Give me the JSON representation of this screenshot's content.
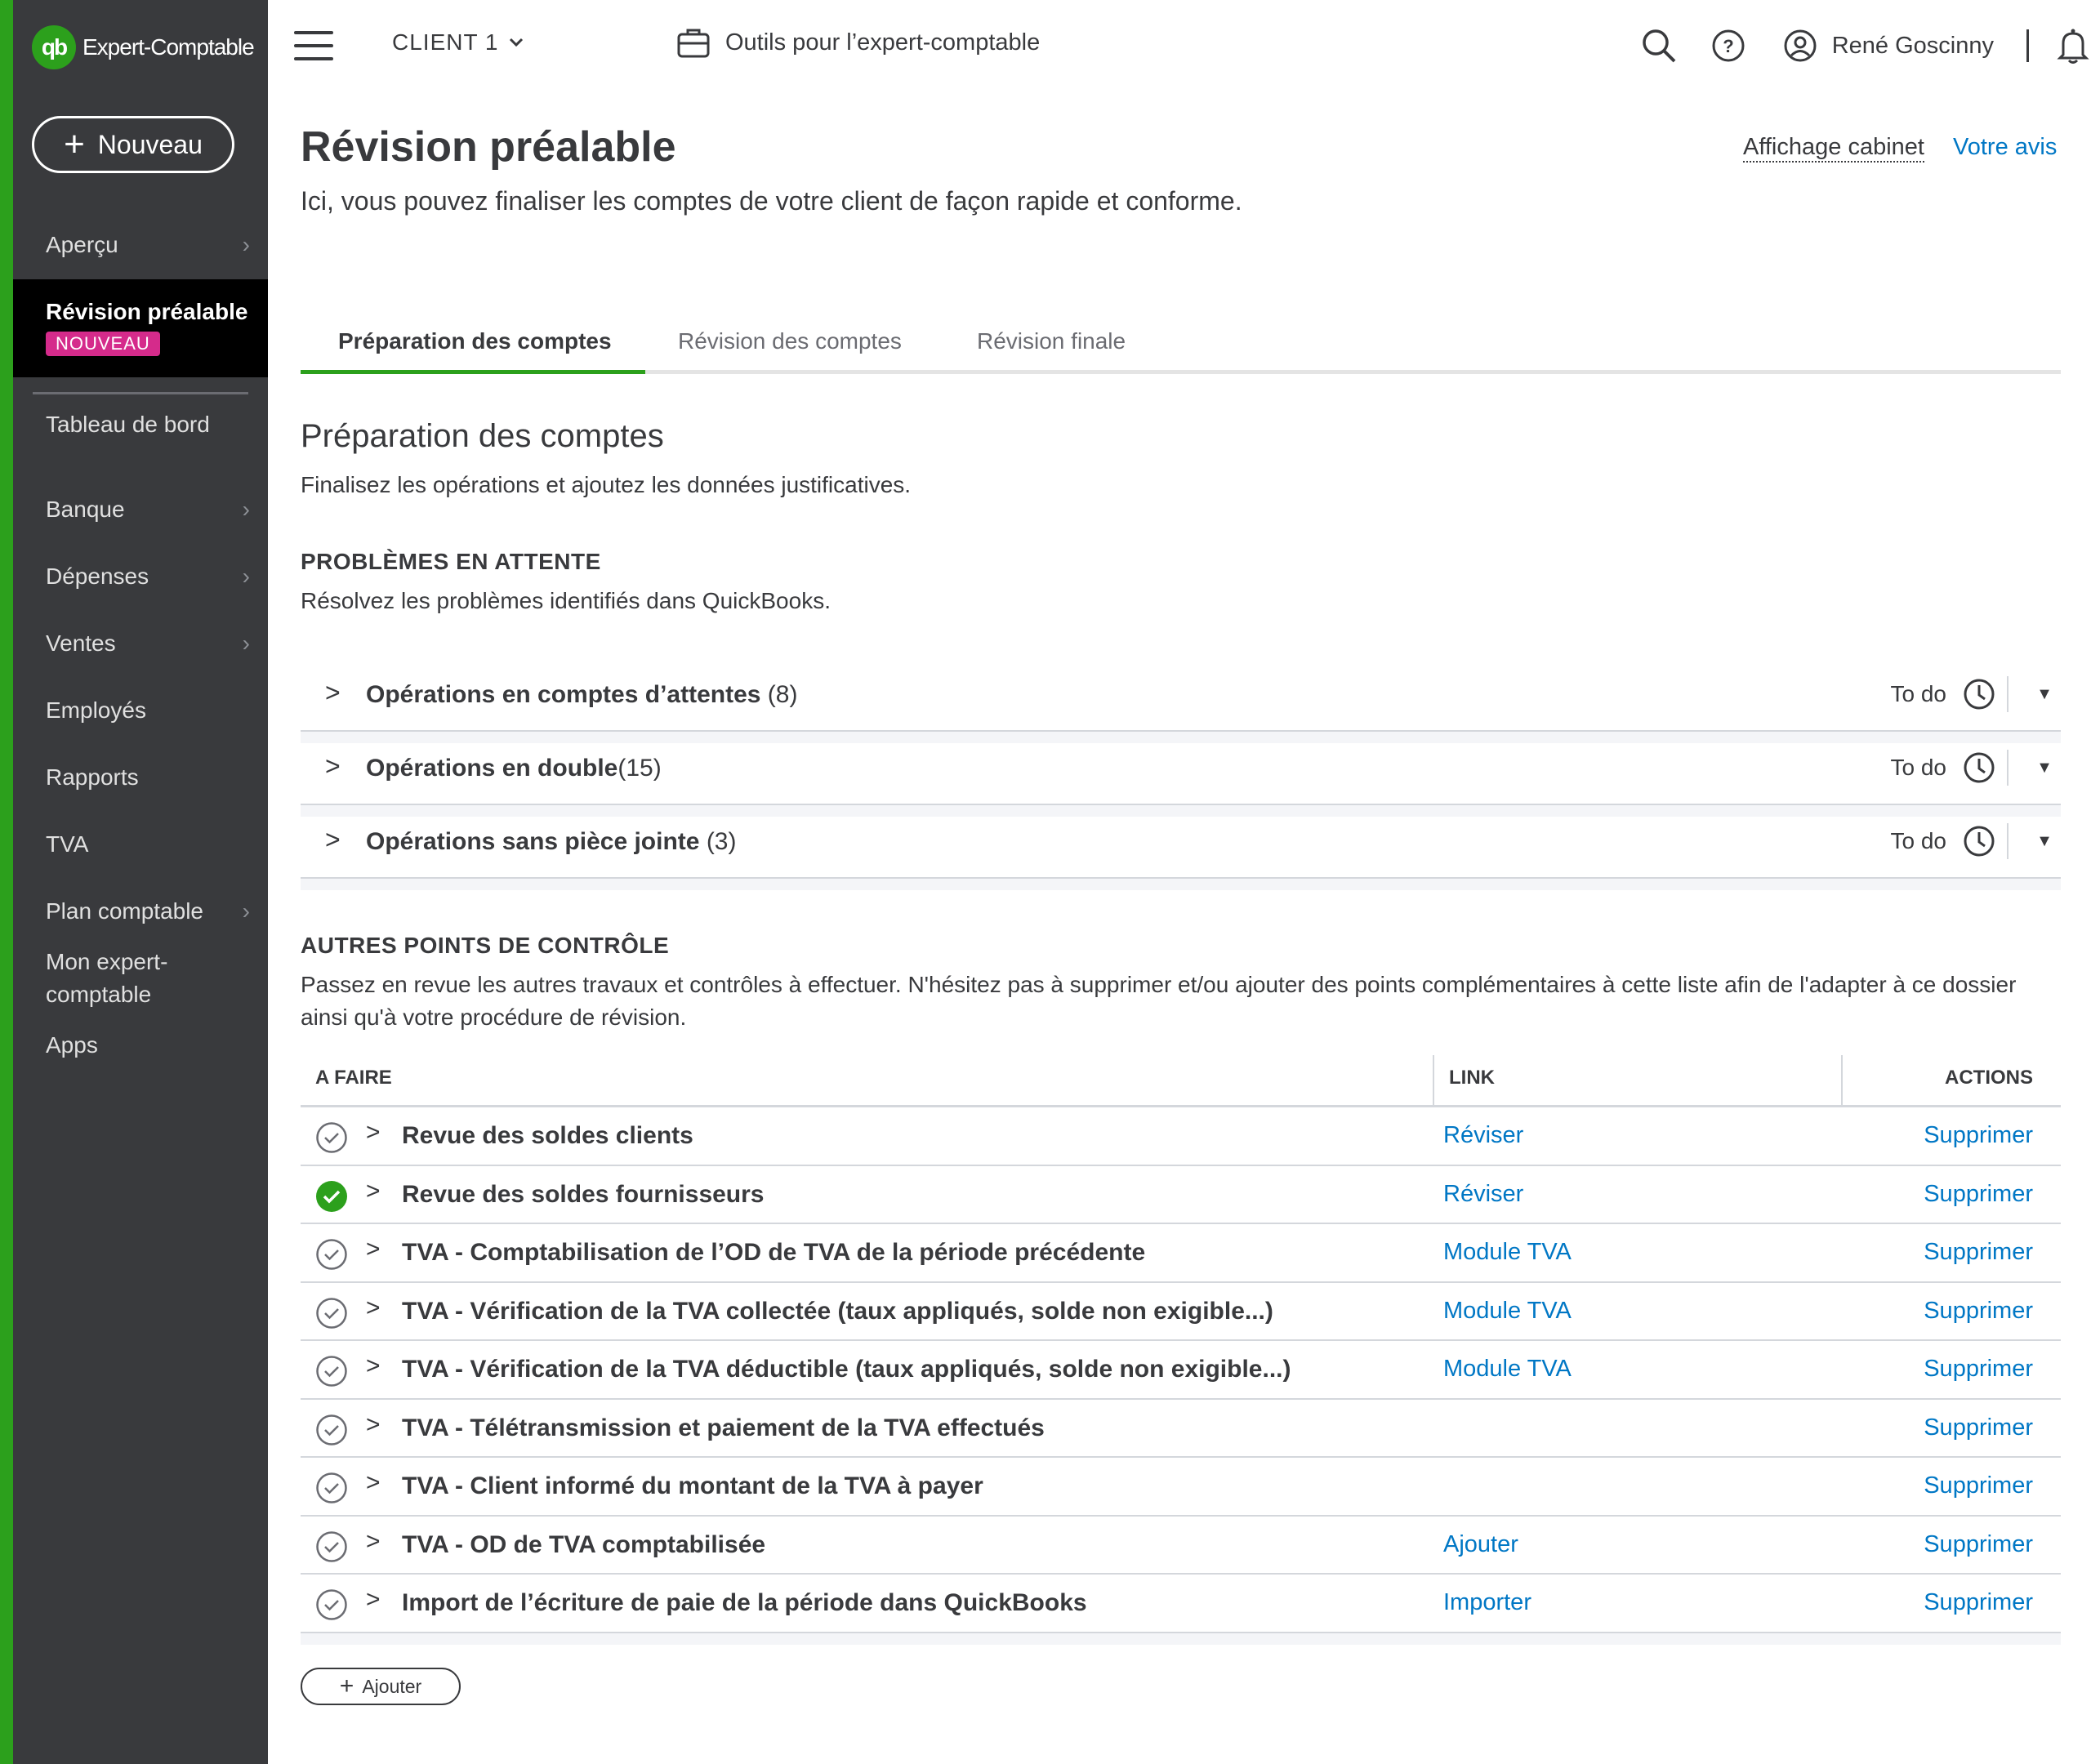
{
  "app": {
    "logo_mark": "qb",
    "logo_text": "Expert-Comptable",
    "brand_color": "#2ca01c",
    "sidebar_bg": "#393a3d",
    "link_color": "#0077c5",
    "badge_color": "#d52b8b"
  },
  "sidebar": {
    "new_button": "Nouveau",
    "active_item": {
      "label": "Révision préalable",
      "badge": "NOUVEAU"
    },
    "items": [
      {
        "label": "Aperçu",
        "has_chevron": true
      },
      {
        "label": "Tableau de bord",
        "has_chevron": false
      },
      {
        "label": "Banque",
        "has_chevron": true
      },
      {
        "label": "Dépenses",
        "has_chevron": true
      },
      {
        "label": "Ventes",
        "has_chevron": true
      },
      {
        "label": "Employés",
        "has_chevron": false
      },
      {
        "label": "Rapports",
        "has_chevron": false
      },
      {
        "label": "TVA",
        "has_chevron": false
      },
      {
        "label": "Plan comptable",
        "has_chevron": true
      },
      {
        "label": "Mon expert-comptable",
        "has_chevron": false
      },
      {
        "label": "Apps",
        "has_chevron": false
      }
    ]
  },
  "topbar": {
    "client": "CLIENT 1",
    "tools_label": "Outils pour l’expert-comptable",
    "user_name": "René Goscinny",
    "icons": [
      "menu-icon",
      "briefcase-icon",
      "search-icon",
      "help-icon",
      "user-icon",
      "bell-icon"
    ]
  },
  "page": {
    "title": "Révision préalable",
    "subtitle": "Ici, vous pouvez finaliser les comptes de votre client de façon rapide et conforme.",
    "link_cabinet": "Affichage cabinet",
    "link_avis": "Votre avis"
  },
  "tabs": [
    {
      "label": "Préparation des comptes",
      "active": true
    },
    {
      "label": "Révision des comptes",
      "active": false
    },
    {
      "label": "Révision finale",
      "active": false
    }
  ],
  "section": {
    "title": "Préparation des comptes",
    "subtitle": "Finalisez les opérations et ajoutez les données justificatives."
  },
  "pending": {
    "heading": "PROBLÈMES EN ATTENTE",
    "description": "Résolvez les problèmes identifiés dans QuickBooks.",
    "items": [
      {
        "label": "Opérations en comptes d’attentes",
        "count": "(8)",
        "status": "To do"
      },
      {
        "label": "Opérations en double",
        "count": "(15)",
        "status": "To do"
      },
      {
        "label": "Opérations sans pièce jointe",
        "count": "(3)",
        "status": "To do"
      }
    ]
  },
  "others": {
    "heading": "AUTRES POINTS DE CONTRÔLE",
    "description": "Passez en revue les autres travaux et contrôles à effectuer. N'hésitez pas à supprimer et/ou ajouter des points complémentaires à cette liste afin de l'adapter à ce dossier ainsi qu'à votre procédure de révision.",
    "columns": {
      "todo": "A FAIRE",
      "link": "LINK",
      "actions": "ACTIONS"
    },
    "rows": [
      {
        "task": "Revue des soldes clients",
        "link": "Réviser",
        "action": "Supprimer",
        "done": false
      },
      {
        "task": "Revue des soldes fournisseurs",
        "link": "Réviser",
        "action": "Supprimer",
        "done": true
      },
      {
        "task": "TVA - Comptabilisation de l’OD de TVA de la période précédente",
        "link": "Module TVA",
        "action": "Supprimer",
        "done": false
      },
      {
        "task": "TVA - Vérification de la TVA collectée (taux appliqués, solde non exigible...)",
        "link": "Module TVA",
        "action": "Supprimer",
        "done": false
      },
      {
        "task": "TVA - Vérification de la TVA déductible (taux appliqués, solde non exigible...)",
        "link": "Module TVA",
        "action": "Supprimer",
        "done": false
      },
      {
        "task": "TVA - Télétransmission et paiement de la TVA effectués",
        "link": "",
        "action": "Supprimer",
        "done": false
      },
      {
        "task": "TVA - Client informé du montant de la TVA à payer",
        "link": "",
        "action": "Supprimer",
        "done": false
      },
      {
        "task": "TVA - OD de TVA comptabilisée",
        "link": "Ajouter",
        "action": "Supprimer",
        "done": false
      },
      {
        "task": "Import de l’écriture de paie de la période dans QuickBooks",
        "link": "Importer",
        "action": "Supprimer",
        "done": false
      }
    ],
    "add_button": "Ajouter"
  }
}
